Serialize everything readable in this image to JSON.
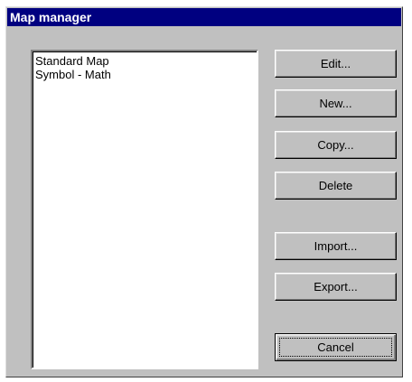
{
  "dialog": {
    "title": "Map manager"
  },
  "maps_list": {
    "items": [
      {
        "label": "Standard Map"
      },
      {
        "label": "Symbol - Math"
      }
    ]
  },
  "buttons": {
    "edit": "Edit...",
    "new": "New...",
    "copy": "Copy...",
    "delete": "Delete",
    "import": "Import...",
    "export": "Export...",
    "cancel": "Cancel"
  },
  "colors": {
    "titlebar": "#000080",
    "dialog_face": "#c0c0c0",
    "list_background": "#ffffff"
  }
}
